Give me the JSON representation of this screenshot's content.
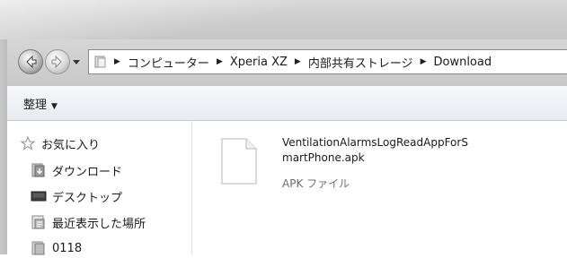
{
  "nav": {
    "back_icon": "back-arrow-icon",
    "forward_icon": "forward-arrow-icon",
    "history_icon": "chevron-down-icon"
  },
  "address": {
    "crumbs": [
      "コンピューター",
      "Xperia XZ",
      "内部共有ストレージ",
      "Download"
    ]
  },
  "toolbar": {
    "organize_label": "整理"
  },
  "navpane": {
    "items": [
      {
        "label": "お気に入り",
        "icon": "star-icon"
      },
      {
        "label": "ダウンロード",
        "icon": "download-folder-icon"
      },
      {
        "label": "デスクトップ",
        "icon": "desktop-icon"
      },
      {
        "label": "最近表示した場所",
        "icon": "recent-places-icon"
      },
      {
        "label": "0118",
        "icon": "folder-icon"
      }
    ]
  },
  "file": {
    "name_line1": "VentilationAlarmsLogReadAppForS",
    "name_line2": "martPhone.apk",
    "type": "APK ファイル",
    "icon": "document-icon"
  }
}
